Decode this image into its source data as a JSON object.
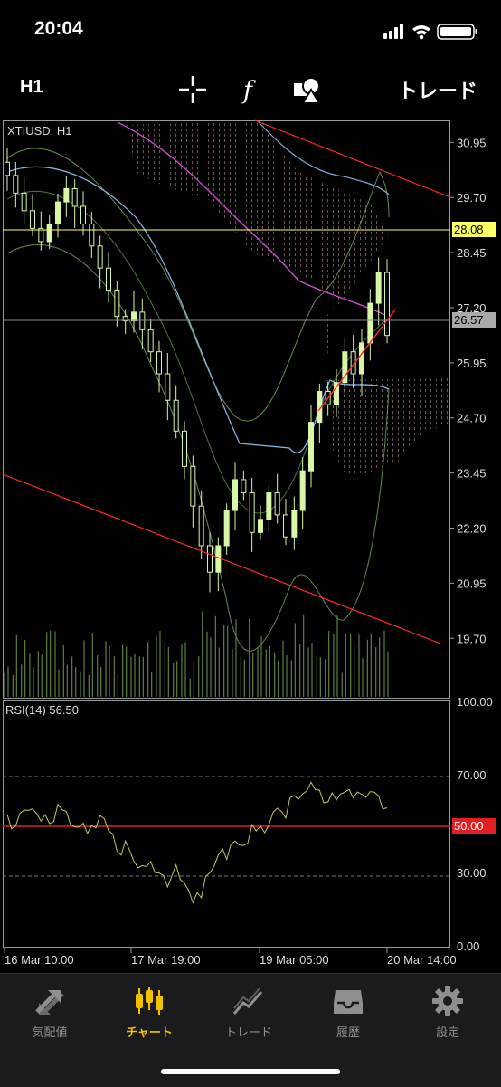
{
  "status_bar": {
    "time": "20:04"
  },
  "toolbar": {
    "period": "H1",
    "trade_label": "トレード"
  },
  "chart": {
    "symbol_label": "XTIUSD, H1",
    "price_axis": [
      "30.95",
      "29.70",
      "28.45",
      "27.20",
      "25.95",
      "24.70",
      "23.45",
      "22.20",
      "20.95",
      "19.70"
    ],
    "price_range": [
      18.35,
      31.45
    ],
    "horizontal_line_price": "28.08",
    "current_price": "26.57",
    "time_axis": [
      "16 Mar 10:00",
      "17 Mar 19:00",
      "19 Mar 05:00",
      "20 Mar 14:00"
    ]
  },
  "rsi": {
    "label": "RSI(14) 56.50",
    "axis": [
      "100.00",
      "70.00",
      "30.00",
      "0.00"
    ],
    "level_marker": "50.00"
  },
  "chart_data": {
    "type": "candlestick",
    "symbol": "XTIUSD",
    "timeframe": "H1",
    "approx_closes": [
      30.2,
      29.8,
      29.4,
      29.0,
      28.7,
      29.1,
      29.6,
      29.9,
      29.5,
      29.1,
      28.6,
      28.1,
      27.6,
      27.0,
      26.9,
      27.1,
      26.7,
      26.2,
      25.7,
      25.1,
      24.4,
      23.6,
      22.7,
      21.8,
      21.2,
      21.8,
      22.6,
      23.3,
      23.0,
      22.1,
      22.4,
      23.0,
      22.5,
      22.0,
      22.6,
      23.5,
      24.6,
      25.3,
      25.0,
      25.5,
      26.2,
      25.7,
      26.4,
      27.3,
      28.0,
      26.57
    ],
    "horizontal_line": 28.08,
    "current_price": 26.57,
    "rsi_levels": [
      70,
      50,
      30
    ],
    "rsi_value": 56.5
  },
  "tabs": [
    {
      "label": "気配値",
      "icon": "quotes-arrows-icon"
    },
    {
      "label": "チャート",
      "icon": "candlestick-icon",
      "active": true
    },
    {
      "label": "トレード",
      "icon": "trade-line-icon"
    },
    {
      "label": "履歴",
      "icon": "history-tray-icon"
    },
    {
      "label": "設定",
      "icon": "gear-icon"
    }
  ],
  "colors": {
    "accent": "#f2c200",
    "trendline": "#ff2a2a",
    "hline": "#ffff66",
    "candle": "#d8f5a8",
    "rsi_line": "#c8c85a"
  }
}
